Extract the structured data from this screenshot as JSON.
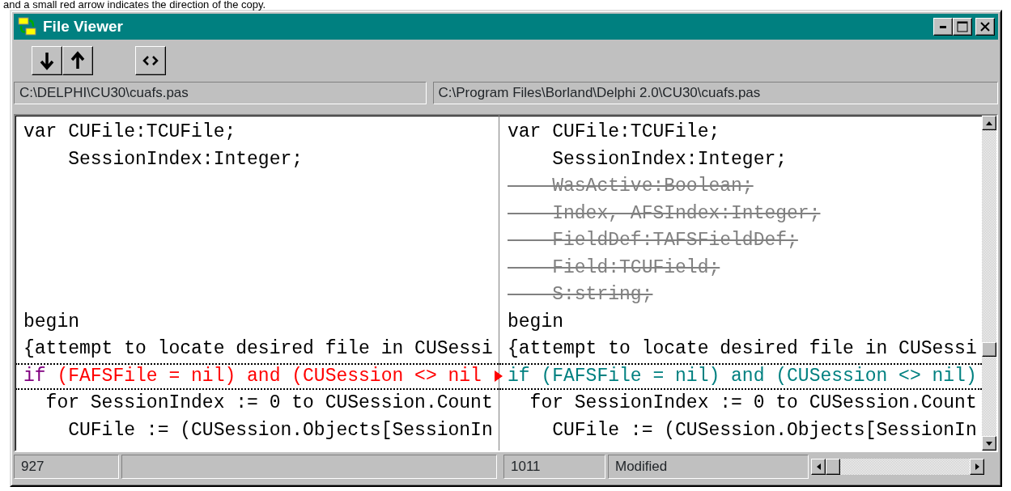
{
  "caption": "and a small red arrow indicates the direction of the copy.",
  "window": {
    "title": "File Viewer"
  },
  "panes": [
    {
      "path": "C:\\DELPHI\\CU30\\cuafs.pas",
      "count": "927",
      "lines": [
        {
          "kind": "same",
          "selected": false,
          "text": "var CUFile:TCUFile;"
        },
        {
          "kind": "same",
          "selected": false,
          "text": "    SessionIndex:Integer;"
        },
        {
          "kind": "blank",
          "selected": false
        },
        {
          "kind": "blank",
          "selected": false
        },
        {
          "kind": "blank",
          "selected": false
        },
        {
          "kind": "blank",
          "selected": false
        },
        {
          "kind": "blank",
          "selected": false
        },
        {
          "kind": "same",
          "selected": false,
          "text": "begin"
        },
        {
          "kind": "same",
          "selected": false,
          "text": "{attempt to locate desired file in CUSessi"
        },
        {
          "kind": "changed",
          "selected": true,
          "segments": [
            {
              "kind": "keyword",
              "text": "if"
            },
            {
              "kind": "old",
              "text": " (FAFSFile = nil) and (CUSession <> nil"
            }
          ]
        },
        {
          "kind": "same",
          "selected": false,
          "text": "  for SessionIndex := 0 to CUSession.Count"
        },
        {
          "kind": "same",
          "selected": false,
          "text": "    CUFile := (CUSession.Objects[SessionIn"
        }
      ]
    },
    {
      "path": "C:\\Program Files\\Borland\\Delphi 2.0\\CU30\\cuafs.pas",
      "count": "1011",
      "state": "Modified",
      "lines": [
        {
          "kind": "same",
          "selected": false,
          "text": "var CUFile:TCUFile;"
        },
        {
          "kind": "same",
          "selected": false,
          "text": "    SessionIndex:Integer;"
        },
        {
          "kind": "removed",
          "selected": false,
          "text": "    WasActive:Boolean;"
        },
        {
          "kind": "removed",
          "selected": false,
          "text": "    Index, AFSIndex:Integer;"
        },
        {
          "kind": "removed",
          "selected": false,
          "text": "    FieldDef:TAFSFieldDef;"
        },
        {
          "kind": "removed",
          "selected": false,
          "text": "    Field:TCUField;"
        },
        {
          "kind": "removed",
          "selected": false,
          "text": "    S:string;"
        },
        {
          "kind": "same",
          "selected": false,
          "text": "begin"
        },
        {
          "kind": "same",
          "selected": false,
          "text": "{attempt to locate desired file in CUSessi"
        },
        {
          "kind": "changed",
          "selected": true,
          "segments": [
            {
              "kind": "new",
              "text": "if (FAFSFile = nil) and (CUSession <> nil)"
            }
          ]
        },
        {
          "kind": "same",
          "selected": false,
          "text": "  for SessionIndex := 0 to CUSession.Count"
        },
        {
          "kind": "same",
          "selected": false,
          "text": "    CUFile := (CUSession.Objects[SessionIn"
        }
      ]
    }
  ]
}
